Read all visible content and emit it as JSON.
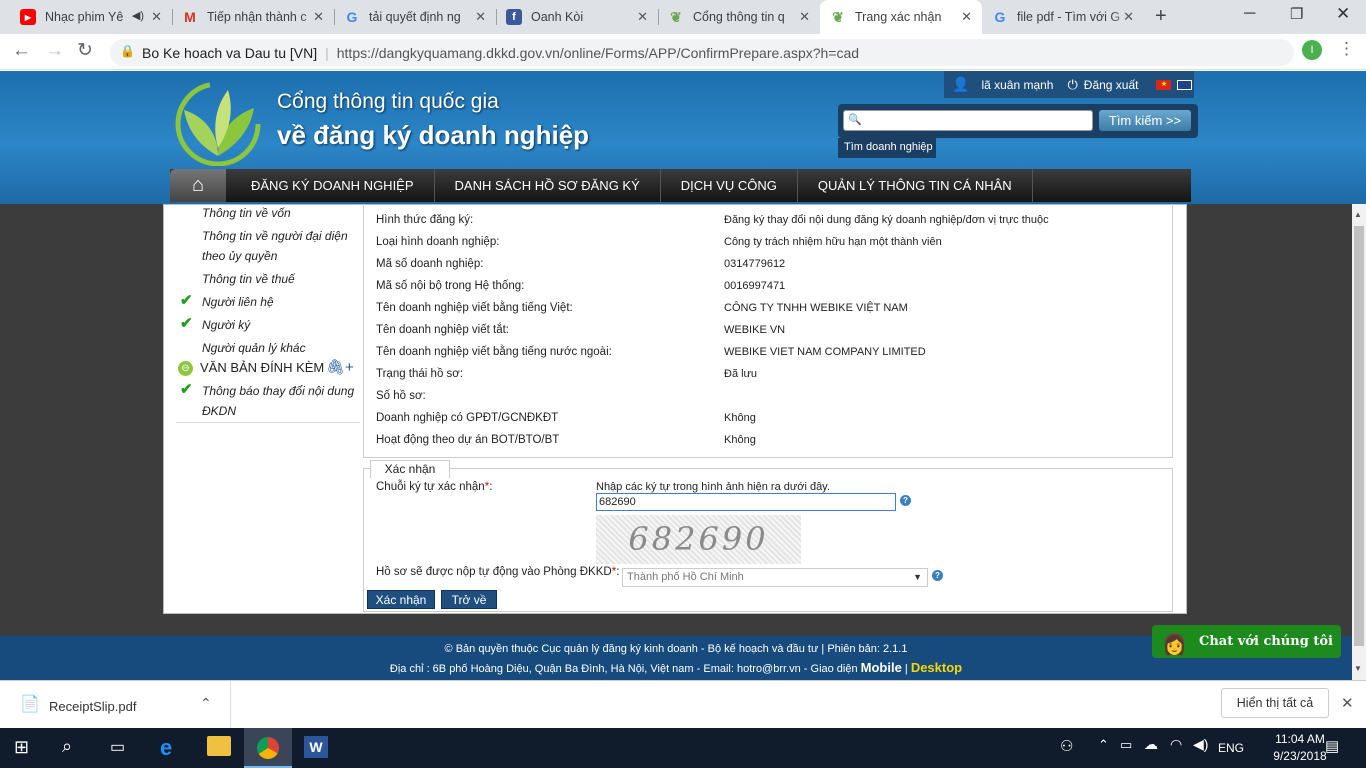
{
  "browser": {
    "tabs": [
      {
        "title": "Nhạc phim Yê",
        "icon": "youtube-icon"
      },
      {
        "title": "Tiếp nhận thành c",
        "icon": "gmail-icon"
      },
      {
        "title": "tải quyết định ng",
        "icon": "google-icon"
      },
      {
        "title": "Oanh Kòi",
        "icon": "facebook-icon"
      },
      {
        "title": "Cổng thông tin q",
        "icon": "site-leaf-icon"
      },
      {
        "title": "Trang xác nhận",
        "icon": "site-leaf-icon"
      },
      {
        "title": "file pdf - Tìm với G",
        "icon": "google-icon"
      }
    ],
    "site_name": "Bo Ke hoach va Dau tu [VN]",
    "url": "https://dangkyquamang.dkkd.gov.vn/online/Forms/APP/ConfirmPrepare.aspx?h=cad",
    "profile_initial": "I"
  },
  "header": {
    "brand_line1": "Cổng thông tin quốc gia",
    "brand_line2": "về đăng ký doanh nghiệp",
    "user_name": "lã xuân mạnh",
    "logout_label": "Đăng xuất",
    "search_placeholder": "",
    "search_button": "Tìm kiếm >>",
    "search_tab": "Tìm doanh nghiệp"
  },
  "nav": {
    "items": [
      "ĐĂNG KÝ DOANH NGHIỆP",
      "DANH SÁCH HỒ SƠ ĐĂNG KÝ",
      "DỊCH VỤ CÔNG",
      "QUẢN LÝ THÔNG TIN CÁ NHÂN"
    ]
  },
  "sidebar": {
    "items": [
      {
        "label": "Thông tin về vốn",
        "checked": false
      },
      {
        "label": "Thông tin về người đại diện",
        "checked": false
      },
      {
        "label": "theo ủy quyền",
        "checked": false
      },
      {
        "label": "Thông tin về thuế",
        "checked": false
      },
      {
        "label": "Người liên hệ",
        "checked": true
      },
      {
        "label": "Người ký",
        "checked": true
      },
      {
        "label": "Người quản lý khác",
        "checked": false
      }
    ],
    "section_title": "VĂN BẢN ĐÍNH KÈM",
    "attachment_line1": "Thông báo thay đổi nội dung",
    "attachment_line2": "ĐKDN"
  },
  "info": {
    "rows": [
      {
        "label": "Hình thức đăng ký:",
        "value": "Đăng ký thay đổi nội dung đăng ký doanh nghiệp/đơn vị trực thuộc"
      },
      {
        "label": "Loại hình doanh nghiệp:",
        "value": "Công ty trách nhiệm hữu hạn một thành viên"
      },
      {
        "label": "Mã số doanh nghiệp:",
        "value": "0314779612"
      },
      {
        "label": "Mã số nội bộ trong Hệ thống:",
        "value": "0016997471"
      },
      {
        "label": "Tên doanh nghiệp viết bằng tiếng Việt:",
        "value": "CÔNG TY TNHH WEBIKE VIỆT NAM"
      },
      {
        "label": "Tên doanh nghiệp viết tắt:",
        "value": "WEBIKE VN"
      },
      {
        "label": "Tên doanh nghiệp viết bằng tiếng nước ngoài:",
        "value": "WEBIKE VIET NAM COMPANY LIMITED"
      },
      {
        "label": "Trạng thái hồ sơ:",
        "value": "Đã lưu"
      },
      {
        "label": "Số hồ sơ:",
        "value": ""
      },
      {
        "label": "Doanh nghiệp có GPĐT/GCNĐKĐT",
        "value": "Không"
      },
      {
        "label": "Hoạt động theo dự án BOT/BTO/BT",
        "value": "Không"
      }
    ]
  },
  "confirm": {
    "legend": "Xác nhận",
    "captcha_label": "Chuỗi ký tự xác nhận",
    "required_mark": "*",
    "captcha_hint": "Nhập các ký tự trong hình ảnh hiện ra dưới đây.",
    "captcha_value": "682690",
    "captcha_image_text": "682690",
    "office_label": "Hồ sơ sẽ được nộp tự động vào Phòng ĐKKD",
    "office_value": "Thành phố Hồ Chí Minh",
    "confirm_button": "Xác nhận",
    "back_button": "Trở về"
  },
  "footer": {
    "line1": "© Bản quyền thuộc Cục quản lý đăng ký kinh doanh - Bộ kế hoạch và đầu tư | Phiên bản: 2.1.1",
    "line2_prefix": "Địa chỉ : 6B phố Hoàng Diệu, Quận Ba Đình, Hà Nội, Việt nam - Email: ",
    "email": "hotro@brr.vn",
    "line2_mid": " - Giao diện ",
    "mobile": "Mobile",
    "sep": " | ",
    "desktop": "Desktop",
    "chat": "Chat với chúng tôi"
  },
  "downloads": {
    "file": "ReceiptSlip.pdf",
    "show_all": "Hiển thị tất cả"
  },
  "taskbar": {
    "lang": "ENG",
    "time": "11:04 AM",
    "date": "9/23/2018"
  },
  "colors": {
    "header_blue": "#2c86c7",
    "nav_black": "#141414",
    "button_blue": "#1e4f7f",
    "check_green": "#1f9e1f",
    "chat_green": "#1c8a1c",
    "desktop_yellow": "#f5d800"
  }
}
